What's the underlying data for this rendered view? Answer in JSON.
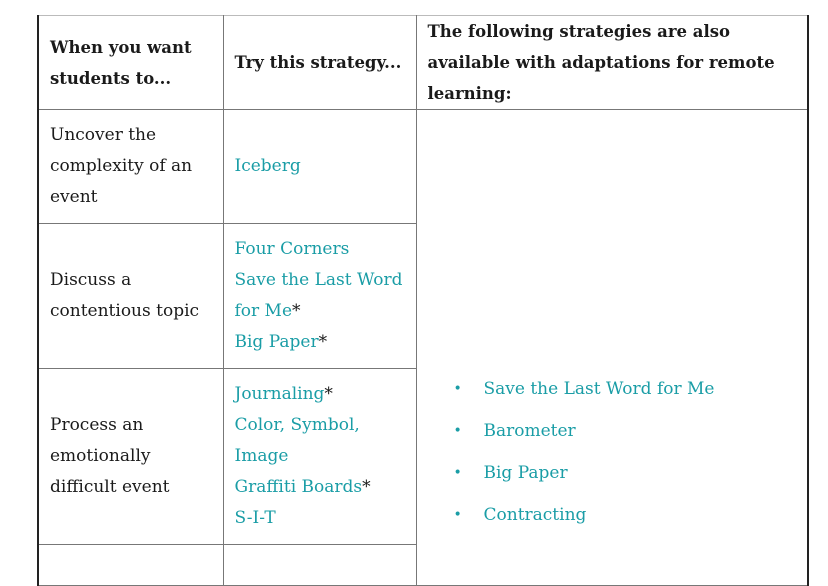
{
  "table": {
    "headers": [
      "When you want students to...",
      "Try this strategy...",
      "The following strategies are also available with adaptations for remote learning:"
    ],
    "rows": [
      {
        "goal": "Uncover the complexity of an event",
        "strategies": [
          {
            "label": "Iceberg",
            "asterisk": ""
          }
        ]
      },
      {
        "goal": "Discuss a contentious topic",
        "strategies": [
          {
            "label": "Four Corners",
            "asterisk": ""
          },
          {
            "label": "Save the Last Word for Me",
            "asterisk": "*"
          },
          {
            "label": "Big Paper",
            "asterisk": "*"
          }
        ]
      },
      {
        "goal": "Process an emotionally difficult event",
        "strategies": [
          {
            "label": "Journaling",
            "asterisk": "*"
          },
          {
            "label": "Color, Symbol, Image",
            "asterisk": ""
          },
          {
            "label": "Graffiti Boards",
            "asterisk": "*"
          },
          {
            "label": "S-I-T",
            "asterisk": ""
          }
        ]
      }
    ],
    "remote_strategies": [
      "Save the Last Word for Me",
      "Barometer",
      "Big Paper",
      "Contracting"
    ],
    "bullet_glyph": "•"
  },
  "colors": {
    "link": "#1a9da6",
    "text": "#1a1a1a",
    "border": "#777777"
  }
}
